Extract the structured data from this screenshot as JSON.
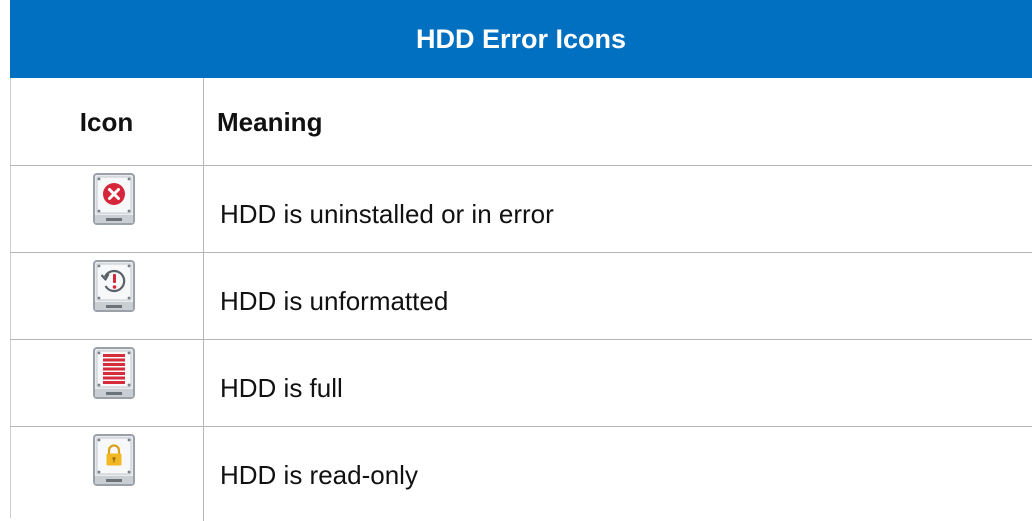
{
  "title": "HDD Error Icons",
  "headers": {
    "icon": "Icon",
    "meaning": "Meaning"
  },
  "rows": [
    {
      "icon": "hdd-error-icon",
      "meaning": "HDD is uninstalled or in error"
    },
    {
      "icon": "hdd-unformatted-icon",
      "meaning": "HDD is unformatted"
    },
    {
      "icon": "hdd-full-icon",
      "meaning": "HDD is full"
    },
    {
      "icon": "hdd-read-only-icon",
      "meaning": "HDD is read-only"
    }
  ],
  "colors": {
    "title_bar": "#0170c1",
    "error_red": "#d6263a",
    "full_red": "#d62c3c",
    "lock_gold": "#f2b824",
    "grid": "#b5b5b5"
  }
}
